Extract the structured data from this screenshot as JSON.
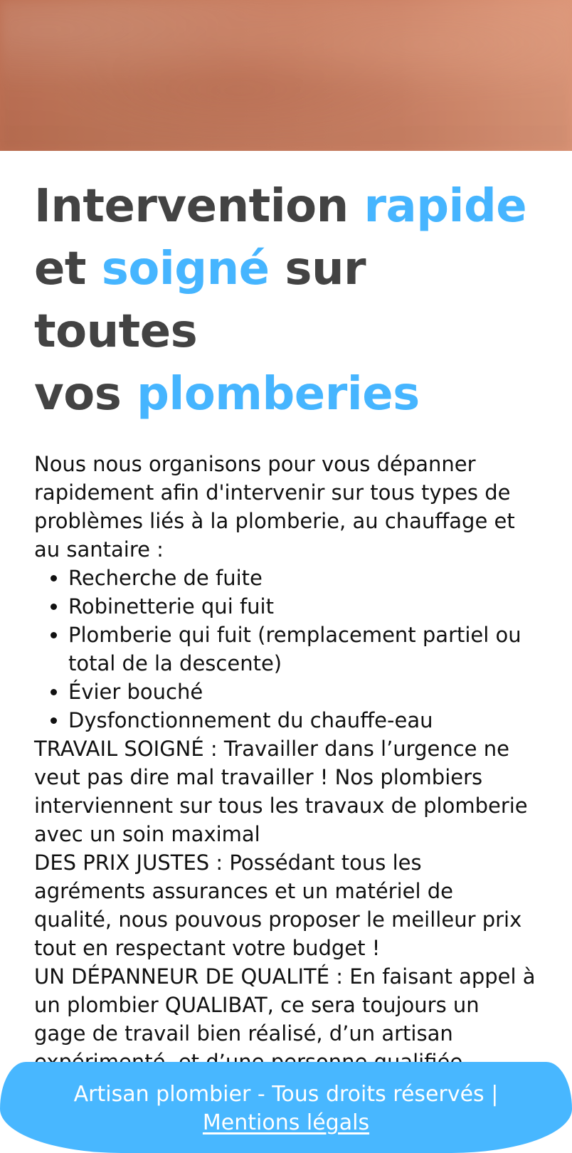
{
  "hero": {
    "image_alt": "hero-image"
  },
  "headline": {
    "line1_main": "Intervention",
    "line1_accent": "rapide",
    "line2_start": "et",
    "line2_accent": "soigné",
    "line2_end": "sur toutes",
    "line3_start": "vos",
    "line3_accent": "plomberies"
  },
  "content": {
    "intro": "Nous nous organisons pour vous dépanner rapidement afin d'intervenir sur tous types de problèmes liés à la plomberie, au chauffage et au santaire :",
    "services": [
      "Recherche de fuite",
      "Robinetterie qui fuit",
      "Plomberie qui fuit (remplacement partiel ou total de la descente)",
      "Évier bouché",
      "Dysfonctionnement du chauffe-eau"
    ],
    "paragraph1": "TRAVAIL SOIGNÉ : Travailler dans l’urgence ne veut pas dire mal travailler ! Nos plombiers interviennent sur tous les travaux de plomberie avec un soin maximal",
    "paragraph2": "DES PRIX JUSTES : Possédant tous les agréments assurances et un matériel de qualité, nous pouvous proposer le meilleur prix tout en respectant votre budget !",
    "paragraph3": "UN DÉPANNEUR DE QUALITÉ : En faisant appel à un plombier QUALIBAT, ce sera toujours un gage de travail bien réalisé, d’un artisan expérimenté, et d’une personne qualifiée."
  },
  "footer": {
    "copyright": "Artisan plombier - Tous droits réservés |",
    "legal_link": "Mentions légals"
  },
  "colors": {
    "heading": "#434343",
    "accent": "#46b5ff",
    "footer_bg": "#48b7ff",
    "hero_start": "#bd6f52",
    "hero_end": "#dc9577"
  }
}
